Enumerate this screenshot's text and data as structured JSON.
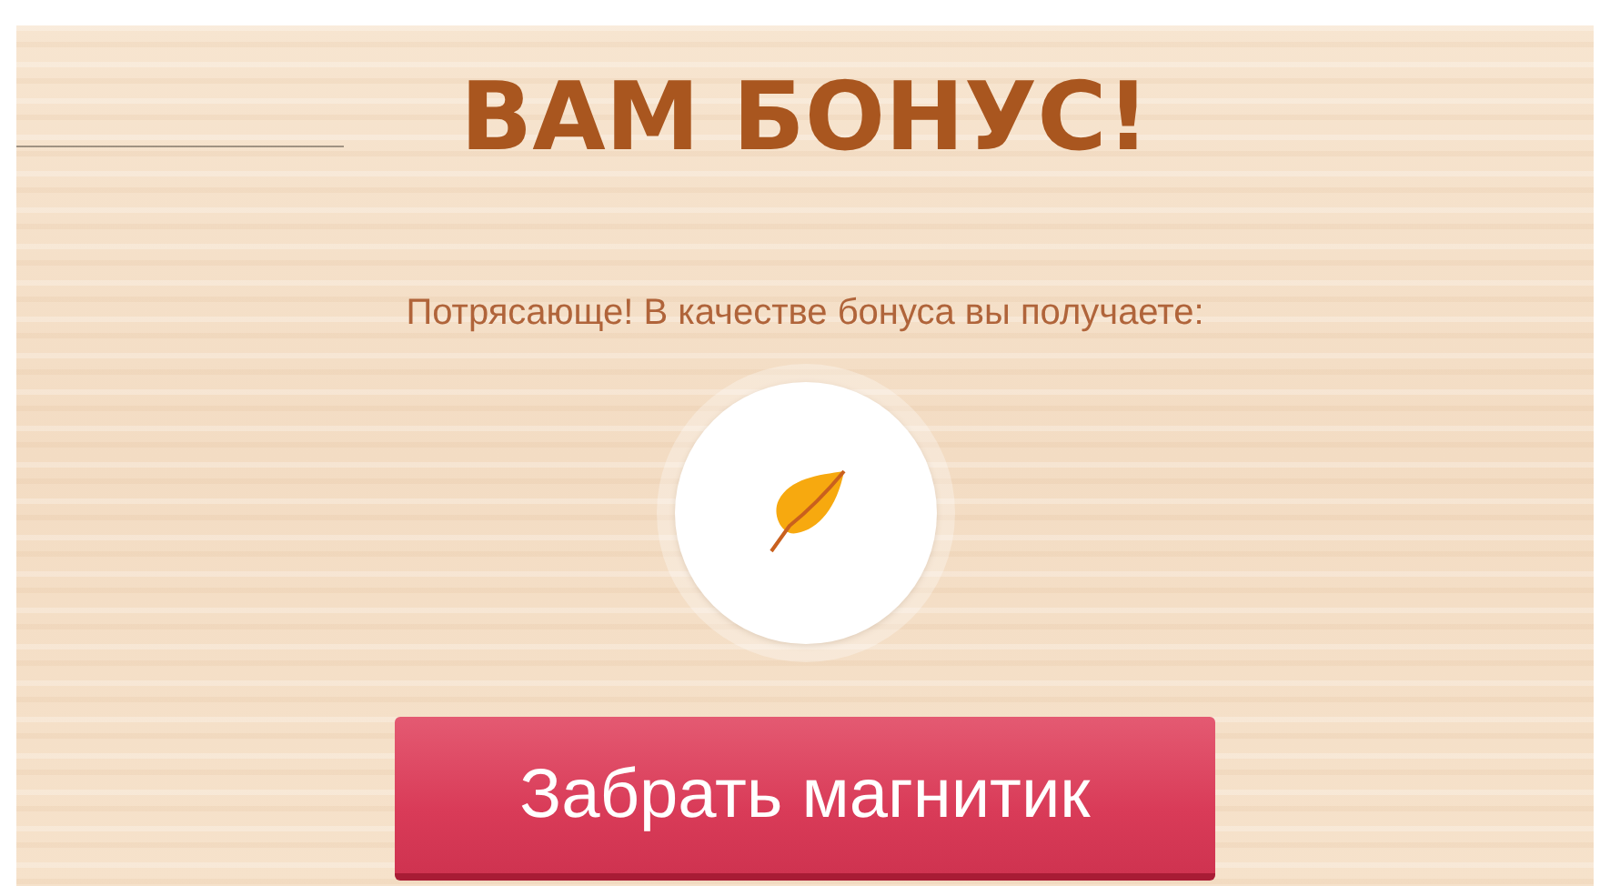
{
  "title": "ВАМ БОНУС!",
  "message": "Потрясающе! В качестве бонуса вы получаете:",
  "reward": {
    "kind": "leaf"
  },
  "button": {
    "label": "Забрать магнитик"
  }
}
